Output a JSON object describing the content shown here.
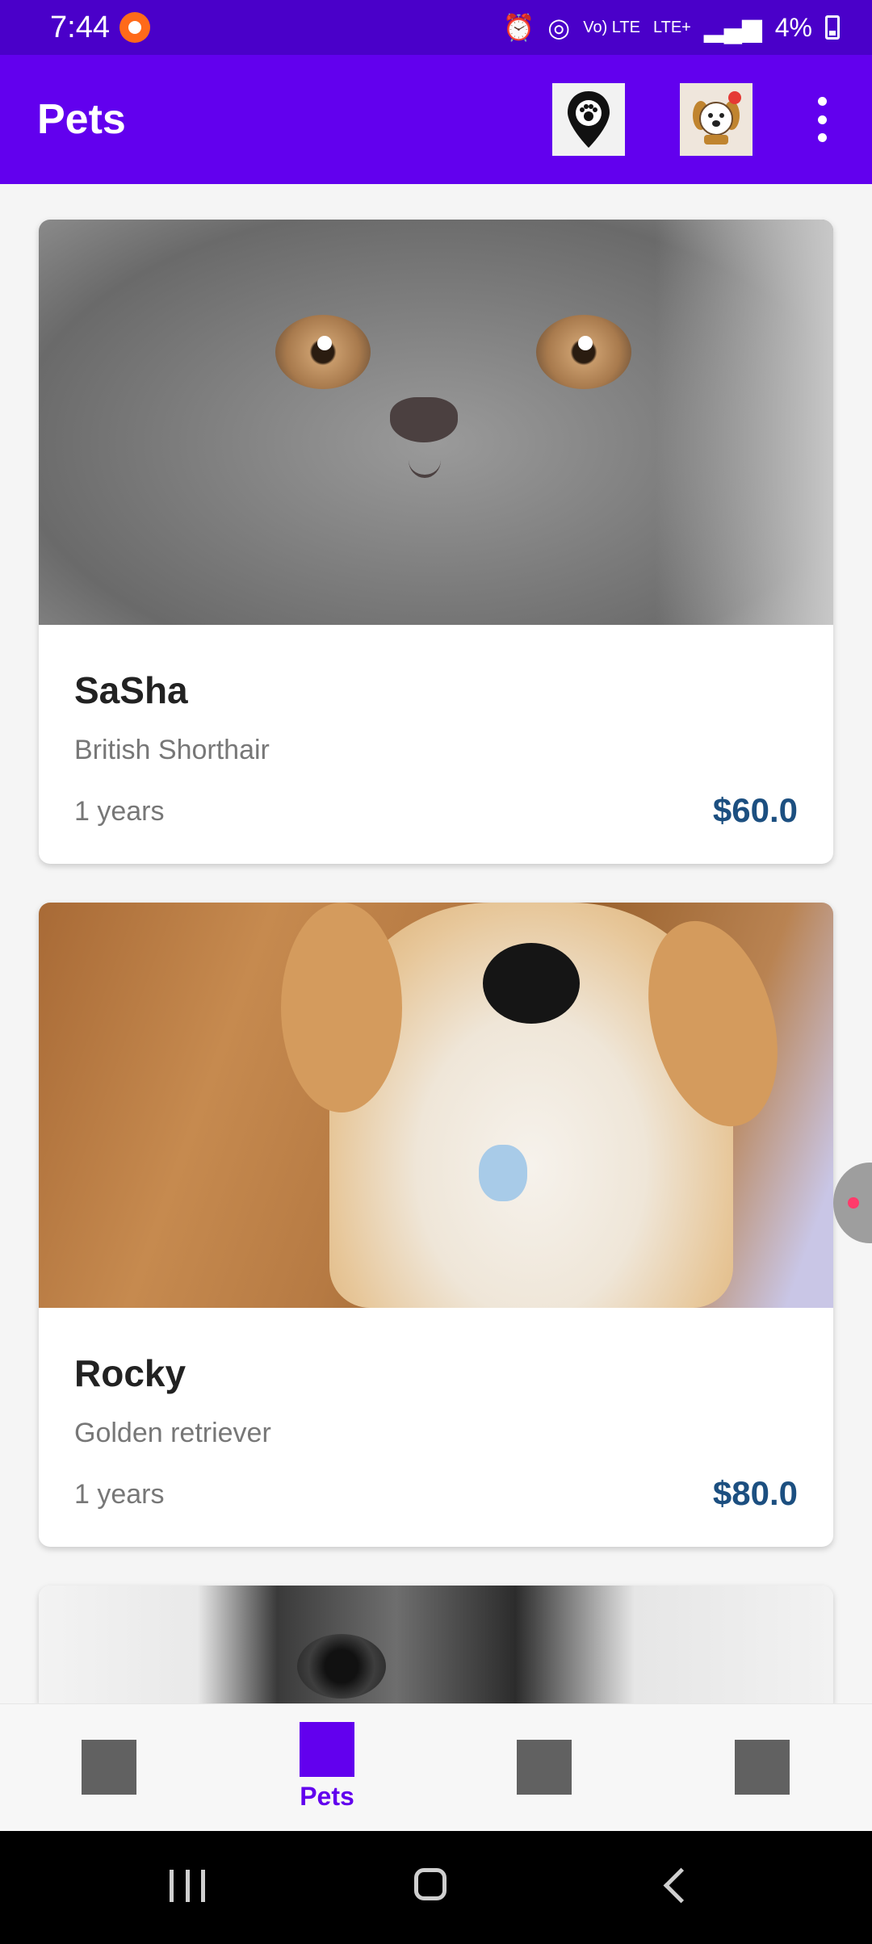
{
  "status_bar": {
    "time": "7:44",
    "network_labels": [
      "Vo) LTE",
      "LTE+"
    ],
    "battery": "4%",
    "icons": [
      "screen-record-icon",
      "alarm-icon",
      "hotspot-icon",
      "signal-icon",
      "battery-icon"
    ]
  },
  "app_bar": {
    "title": "Pets",
    "actions": [
      "location-pin-icon",
      "dog-avatar-icon",
      "more-vertical-icon"
    ]
  },
  "pets": [
    {
      "name": "SaSha",
      "breed": "British Shorthair",
      "age": "1 years",
      "price": "$60.0",
      "image": "grey-cat-photo"
    },
    {
      "name": "Rocky",
      "breed": "Golden retriever",
      "age": "1 years",
      "price": "$80.0",
      "image": "golden-puppy-photo"
    },
    {
      "name": "",
      "breed": "",
      "age": "",
      "price": "",
      "image": "tabby-kitten-photo"
    }
  ],
  "bottom_nav": {
    "items": [
      {
        "label": "",
        "active": false
      },
      {
        "label": "Pets",
        "active": true
      },
      {
        "label": "",
        "active": false
      },
      {
        "label": "",
        "active": false
      }
    ],
    "active_color": "#6200ee",
    "inactive_color": "#616161"
  },
  "colors": {
    "status_bar": "#4a00c9",
    "app_bar": "#6200ee",
    "price": "#1c4f80"
  }
}
